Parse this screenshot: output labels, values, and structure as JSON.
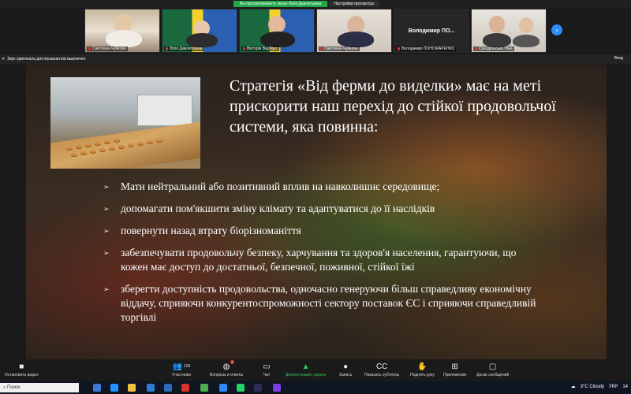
{
  "share_banner": {
    "viewing_text": "Вы просматриваете экран Лілія Давлетшина",
    "view_options": "Настройки просмотра"
  },
  "participants": [
    {
      "name": "Светлана Чуйкова"
    },
    {
      "name": "Лілія Давлетшина"
    },
    {
      "name": "Вікторія Варбрус"
    },
    {
      "name": "Светлана Чуйкова"
    },
    {
      "name": "Володимир ПОНОМАРЕНКО",
      "display_name": "Володимир  ПО..."
    },
    {
      "name": "Суходільська Ніна"
    }
  ],
  "audio_notice": "Звук оригинала для музыкантов выключен",
  "exit_label": "Вход",
  "slide": {
    "title": "Стратегія «Від ферми до виделки» має на меті прискорити наш перехід до стійкої продовольчої системи, яка повинна:",
    "bullets": [
      "Мати нейтральний або позитивний вплив на навколишнє середовище;",
      "допомагати пом'якшити зміну клімату та адаптуватися до її наслідків",
      "повернути назад втрату біорізноманіття",
      "забезпечувати продовольчу безпеку, харчування та здоров'я населення, гарантуючи, що кожен має доступ до достатньої, безпечної, поживної, стійкої їжі",
      "зберегти доступність продовольства, одночасно генеруючи більш справедливу економічну віддачу, сприяючи конкурентоспроможності сектору поставок ЄС і сприяючи справедливій торгівлі"
    ]
  },
  "toolbar": {
    "stop_video": "Остановить видео",
    "participants": "Участники",
    "participants_count": "109",
    "qa": "Вопросы и ответы",
    "chat": "Чат",
    "share_screen": "Демонстрация экрана",
    "record": "Запись",
    "captions": "Показать субтитры",
    "raise_hand": "Поднять руку",
    "apps": "Приложения",
    "whiteboards": "Доски сообщений"
  },
  "taskbar": {
    "search_placeholder": "Поиск",
    "weather": "3°C  Cloudy",
    "language": "УКР",
    "time": "14"
  },
  "colors": {
    "accent_green": "#23a94a",
    "zoom_blue": "#2d8cff"
  }
}
